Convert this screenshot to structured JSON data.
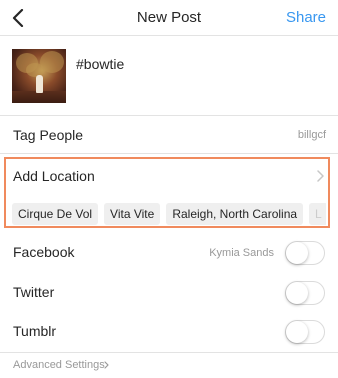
{
  "header": {
    "back_icon": "chevron-left-icon",
    "title": "New Post",
    "share_label": "Share"
  },
  "post": {
    "caption": "#bowtie"
  },
  "tag_people": {
    "label": "Tag People",
    "value": "billgcf"
  },
  "location": {
    "label": "Add Location",
    "chevron_icon": "chevron-right-icon",
    "highlight_color": "#f08a5d",
    "suggestions": [
      "Cirque De Vol",
      "Vita Vite",
      "Raleigh, North Carolina",
      "L"
    ]
  },
  "share_to": [
    {
      "label": "Facebook",
      "account": "Kymia Sands",
      "enabled": false
    },
    {
      "label": "Twitter",
      "account": "",
      "enabled": false
    },
    {
      "label": "Tumblr",
      "account": "",
      "enabled": false
    }
  ],
  "advanced": {
    "label": "Advanced Settings",
    "chevron_icon": "chevron-right-icon"
  },
  "colors": {
    "accent": "#3897f0",
    "text": "#262626",
    "secondary_text": "#999999"
  }
}
